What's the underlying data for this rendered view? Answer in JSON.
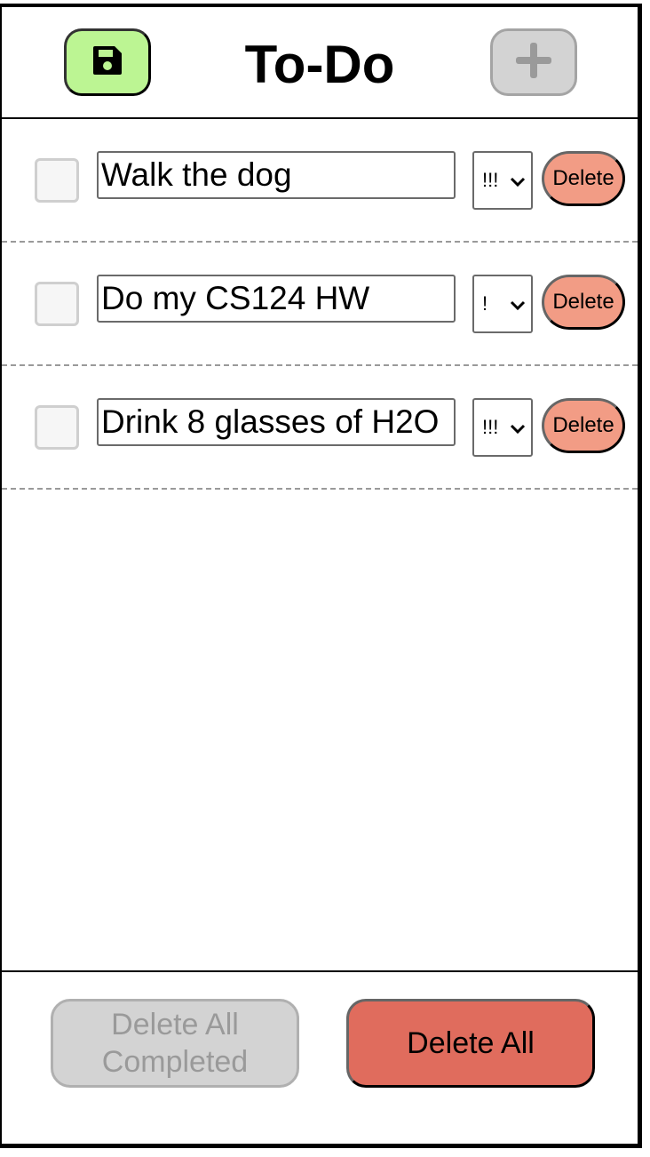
{
  "header": {
    "title": "To-Do",
    "save_icon": "floppy-disk-icon",
    "add_icon": "plus-icon"
  },
  "todos": [
    {
      "text": "Walk the dog",
      "priority": "!!!",
      "done": false,
      "delete_label": "Delete"
    },
    {
      "text": "Do my CS124 HW",
      "priority": "!",
      "done": false,
      "delete_label": "Delete"
    },
    {
      "text": "Drink 8 glasses of H2O",
      "priority": "!!!",
      "done": false,
      "delete_label": "Delete"
    }
  ],
  "footer": {
    "delete_completed_line1": "Delete All",
    "delete_completed_line2": "Completed",
    "delete_all_label": "Delete All"
  },
  "colors": {
    "save_bg": "#bcf593",
    "add_bg": "#d3d3d3",
    "delete_bg": "#f29c85",
    "delete_all_bg": "#e06c5d",
    "disabled_bg": "#d3d3d3"
  }
}
